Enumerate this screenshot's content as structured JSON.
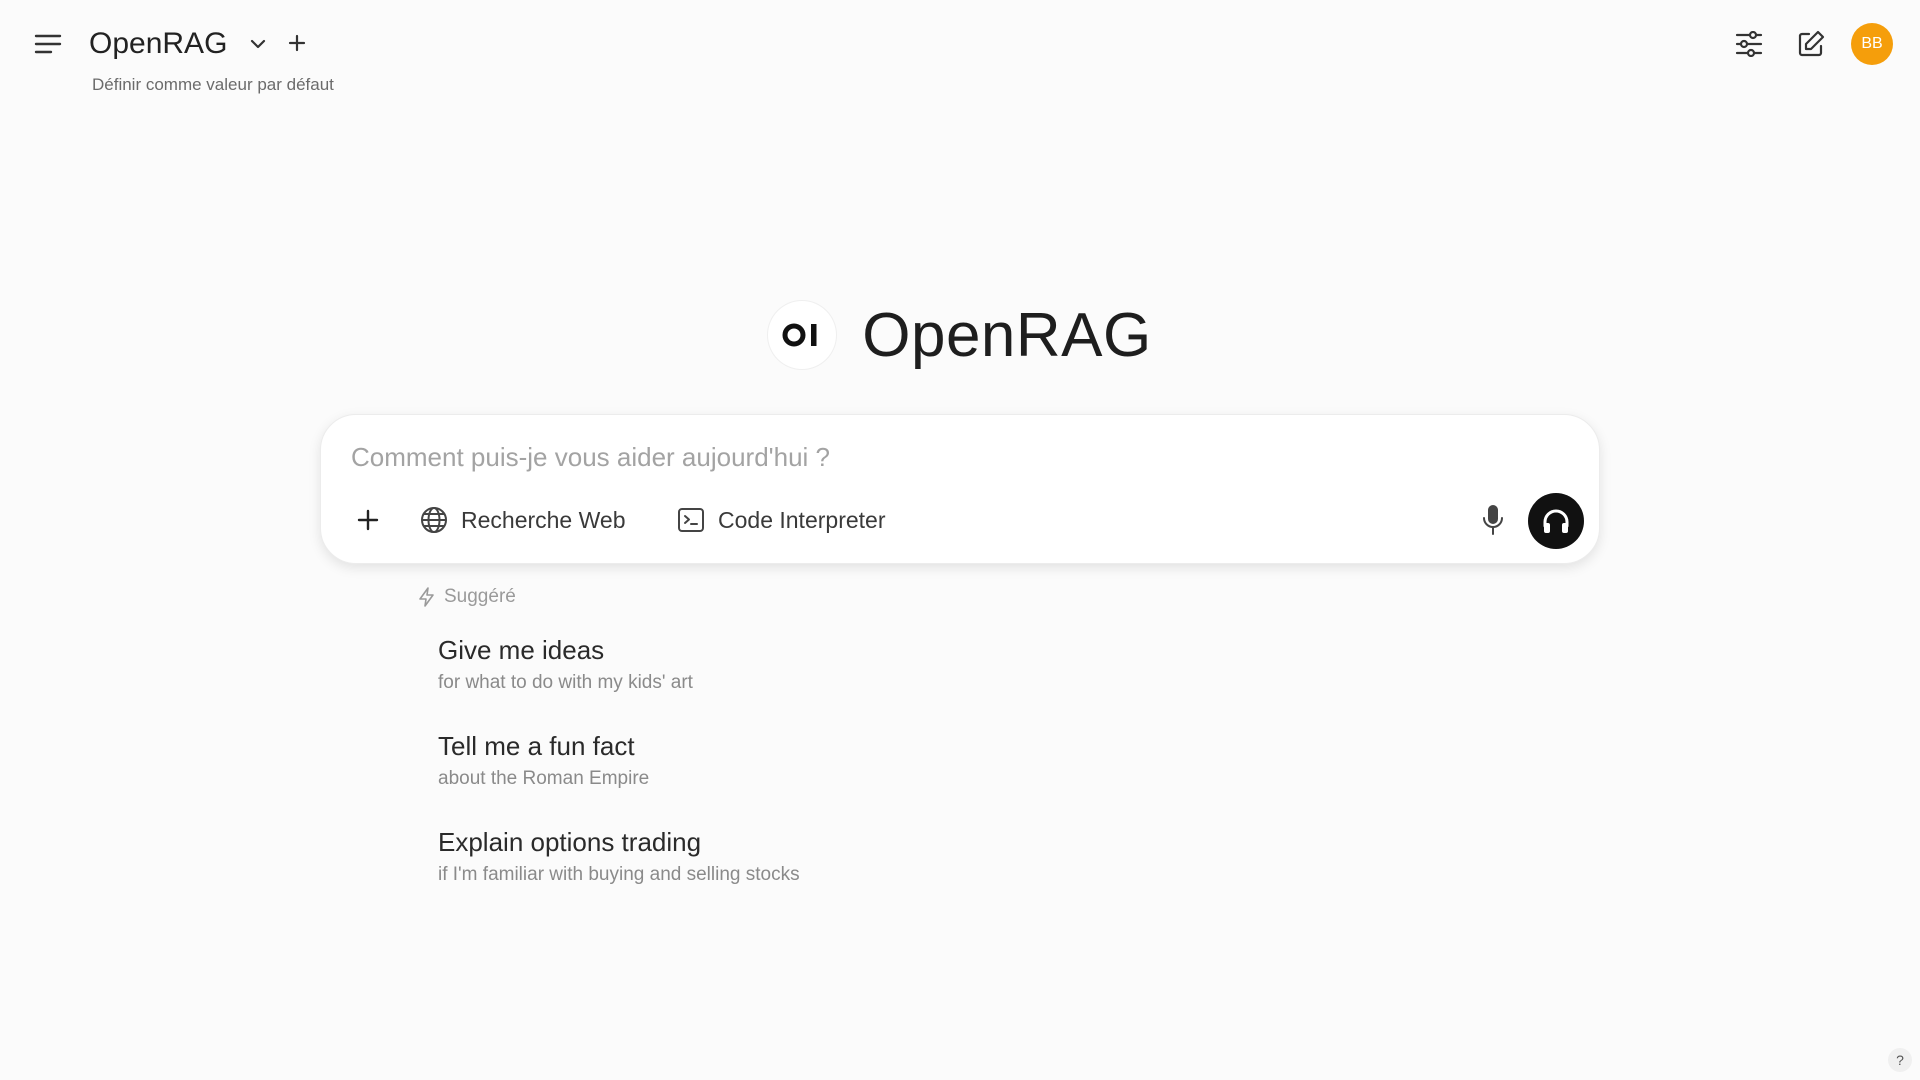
{
  "header": {
    "model_name": "OpenRAG",
    "set_default_label": "Définir comme valeur par défaut",
    "avatar_initials": "BB",
    "avatar_color": "#f59e0b"
  },
  "hero": {
    "logo_text": "OI",
    "brand_name": "OpenRAG"
  },
  "composer": {
    "placeholder": "Comment puis-je vous aider aujourd'hui ?",
    "value": "",
    "tools": [
      {
        "label": "Recherche Web",
        "icon": "globe-icon"
      },
      {
        "label": "Code Interpreter",
        "icon": "terminal-icon"
      }
    ]
  },
  "suggestions": {
    "heading": "Suggéré",
    "items": [
      {
        "title": "Give me ideas",
        "subtitle": "for what to do with my kids' art"
      },
      {
        "title": "Tell me a fun fact",
        "subtitle": "about the Roman Empire"
      },
      {
        "title": "Explain options trading",
        "subtitle": "if I'm familiar with buying and selling stocks"
      }
    ]
  },
  "help_label": "?"
}
